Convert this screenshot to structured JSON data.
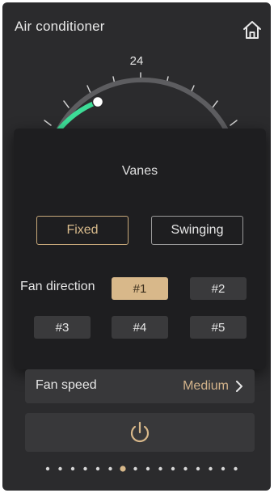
{
  "header": {
    "title": "Air conditioner",
    "home_icon": "home-icon"
  },
  "thermostat": {
    "setpoint": "24"
  },
  "vanes_dialog": {
    "title": "Vanes",
    "modes": [
      {
        "label": "Fixed",
        "selected": true
      },
      {
        "label": "Swinging",
        "selected": false
      }
    ],
    "fan_direction_label": "Fan direction",
    "directions": [
      {
        "label": "#1",
        "selected": true
      },
      {
        "label": "#2",
        "selected": false
      },
      {
        "label": "#3",
        "selected": false
      },
      {
        "label": "#4",
        "selected": false
      },
      {
        "label": "#5",
        "selected": false
      }
    ]
  },
  "fan_speed": {
    "label": "Fan speed",
    "value": "Medium"
  },
  "power": {
    "icon": "power-icon"
  },
  "pager": {
    "total": 16,
    "active_index": 6
  },
  "colors": {
    "background": "#2b2b2d",
    "accent": "#d8b88a",
    "arc_cool": "#3ddc97"
  }
}
